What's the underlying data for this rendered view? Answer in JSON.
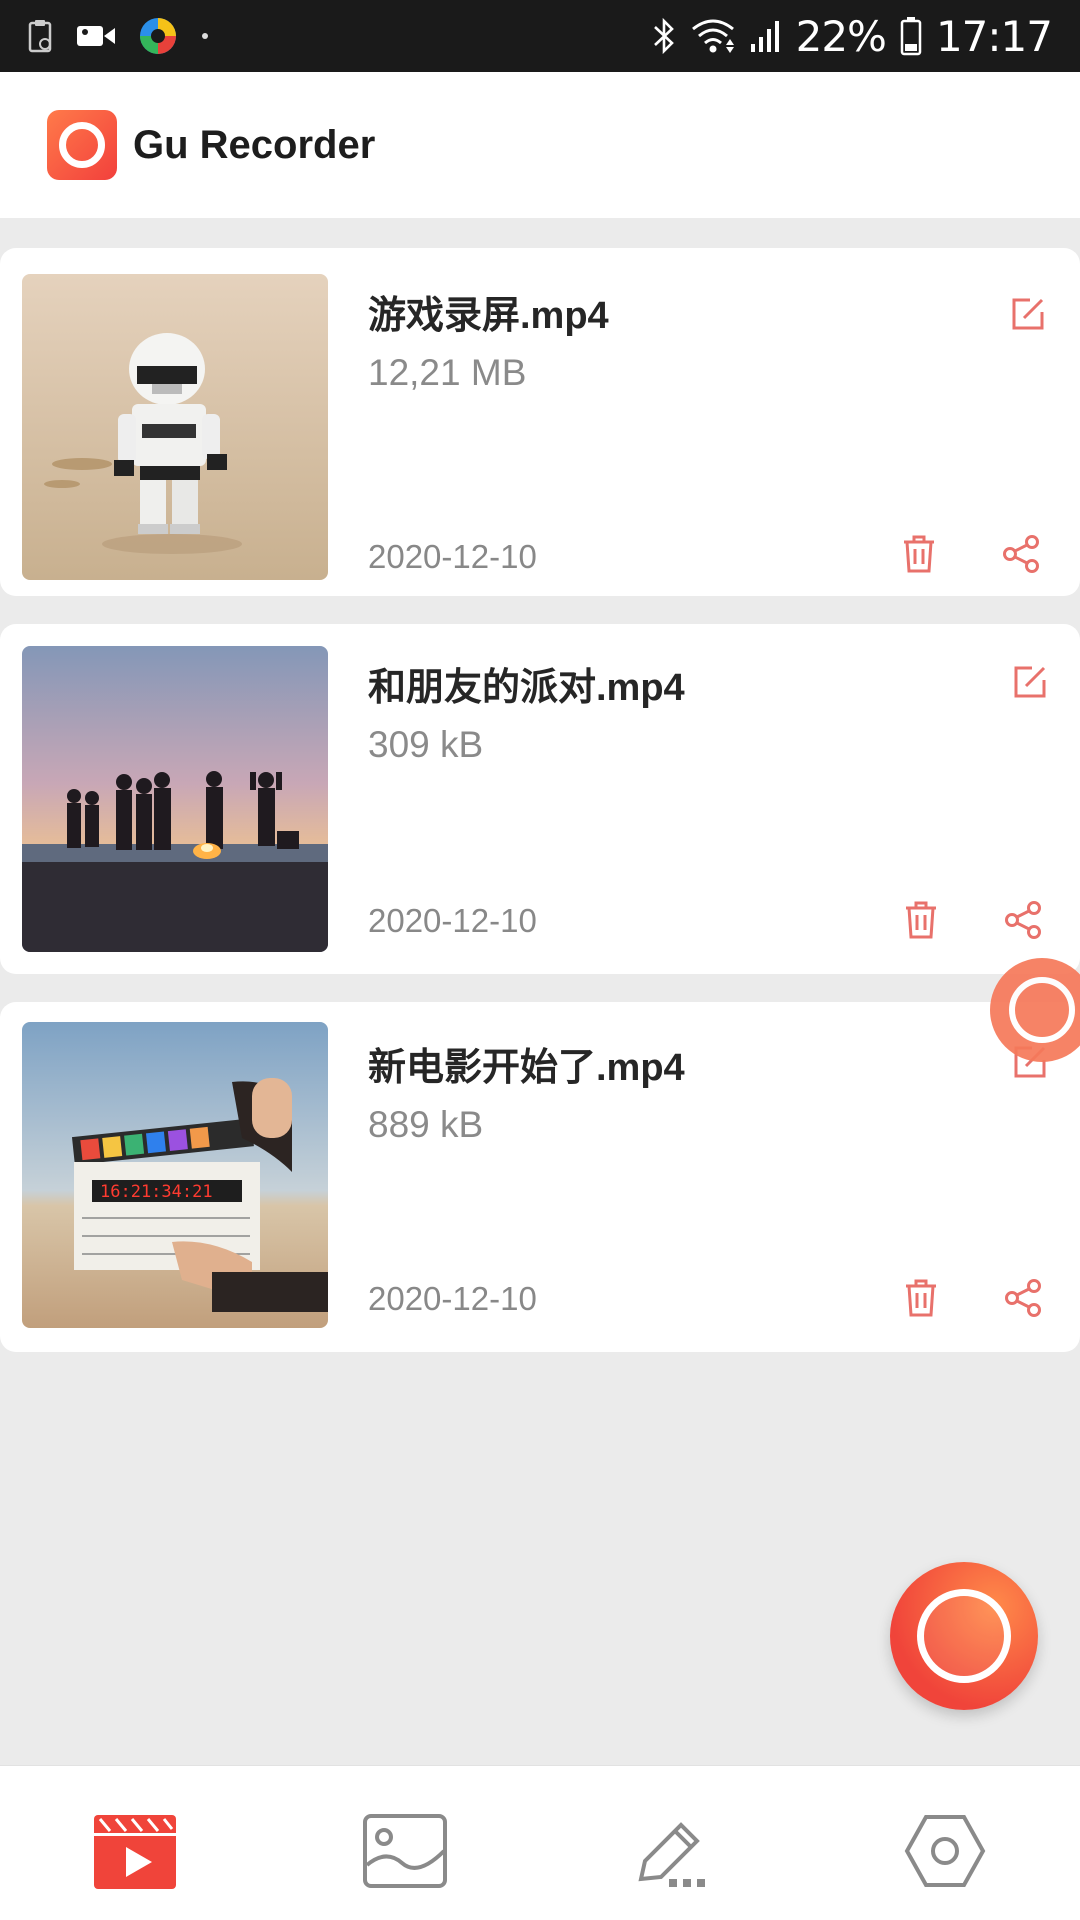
{
  "status_bar": {
    "battery_percent": "22%",
    "time": "17:17",
    "icons": [
      "clipboard-icon",
      "video-camera-icon",
      "app-colorful-icon",
      "dot-icon",
      "bluetooth-icon",
      "wifi-icon",
      "signal-icon",
      "battery-icon"
    ]
  },
  "header": {
    "app_name": "Gu Recorder",
    "logo_icon": "record-logo-icon"
  },
  "recordings": [
    {
      "name": "游戏录屏.mp4",
      "size": "12,21 MB",
      "date": "2020-12-10",
      "thumbnail": "stormtrooper-toy-on-sand"
    },
    {
      "name": "和朋友的派对.mp4",
      "size": "309 kB",
      "date": "2020-12-10",
      "thumbnail": "friends-silhouette-sunset-beach"
    },
    {
      "name": "新电影开始了.mp4",
      "size": "889 kB",
      "date": "2020-12-10",
      "thumbnail": "film-clapperboard-hand"
    }
  ],
  "actions": {
    "edit_icon": "edit-icon",
    "delete_icon": "trash-icon",
    "share_icon": "share-icon"
  },
  "bottom_nav": [
    {
      "id": "videos",
      "icon": "clapperboard-play-icon",
      "active": true
    },
    {
      "id": "images",
      "icon": "image-icon",
      "active": false
    },
    {
      "id": "edit",
      "icon": "pencil-icon",
      "active": false
    },
    {
      "id": "settings",
      "icon": "hexagon-settings-icon",
      "active": false
    }
  ],
  "colors": {
    "accent": "#f0443a",
    "accent_orange": "#ff7a4a",
    "background": "#ebebeb",
    "card": "#ffffff",
    "icon_gray": "#8a8a8a"
  }
}
